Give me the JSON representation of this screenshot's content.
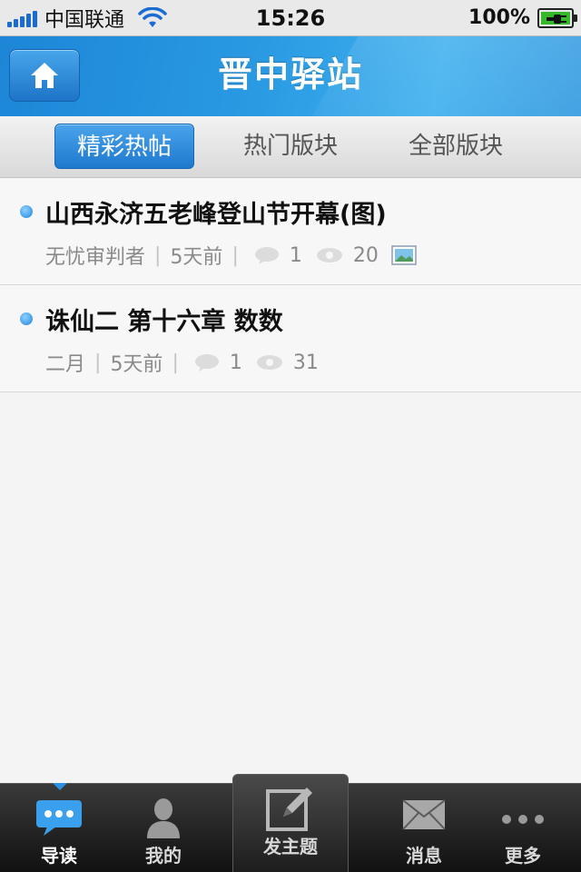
{
  "status_bar": {
    "carrier": "中国联通",
    "time": "15:26",
    "battery": "100%"
  },
  "nav": {
    "title": "晋中驿站",
    "home_icon": "home-icon"
  },
  "tabs": [
    {
      "label": "精彩热帖",
      "active": true
    },
    {
      "label": "热门版块",
      "active": false
    },
    {
      "label": "全部版块",
      "active": false
    }
  ],
  "posts": [
    {
      "title": "山西永济五老峰登山节开幕(图)",
      "author": "无忧审判者",
      "time": "5天前",
      "comments": "1",
      "views": "20",
      "has_image": true
    },
    {
      "title": "诛仙二 第十六章 数数",
      "author": "二月",
      "time": "5天前",
      "comments": "1",
      "views": "31",
      "has_image": false
    }
  ],
  "tab_bar": [
    {
      "label": "导读",
      "icon": "chat-dots-icon",
      "active": true
    },
    {
      "label": "我的",
      "icon": "user-icon",
      "active": false
    },
    {
      "label": "发主题",
      "icon": "compose-icon",
      "active": false
    },
    {
      "label": "消息",
      "icon": "envelope-icon",
      "active": false
    },
    {
      "label": "更多",
      "icon": "more-dots-icon",
      "active": false
    }
  ],
  "colors": {
    "accent": "#1e79cf",
    "nav_bg": "#2a9ae3",
    "tab_bar_bg": "#1a1a1a"
  }
}
